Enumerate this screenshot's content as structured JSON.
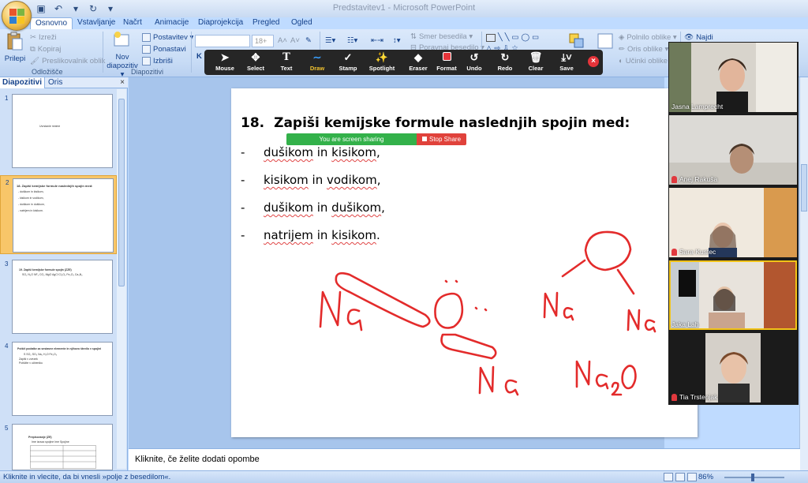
{
  "window": {
    "title": "Predstavitev1 - Microsoft PowerPoint"
  },
  "ribbon_tabs": [
    "Osnovno",
    "Vstavljanje",
    "Načrt",
    "Animacije",
    "Diaprojekcija",
    "Pregled",
    "Ogled"
  ],
  "ribbon": {
    "clipboard": {
      "paste": "Prilepi",
      "cut": "Izreži",
      "copy": "Kopiraj",
      "format_painter": "Preslikovalnik oblik",
      "label": "Odložišče"
    },
    "slides": {
      "new_slide_line1": "Nov",
      "new_slide_line2": "diapozitiv ▾",
      "layout": "Postavitev ▾",
      "reset": "Ponastavi",
      "delete": "Izbriši",
      "label": "Diapozitivi"
    },
    "font": {
      "size": "18+",
      "bold": "K"
    },
    "paragraph": {
      "text_direction": "Smer besedila ▾",
      "align_text": "Poravnaj besedilo ▾"
    },
    "drawing": {
      "fill": "Polnilo oblike ▾",
      "outline": "Oris oblike ▾",
      "effects": "Učinki oblike ▾"
    },
    "editing": {
      "find": "Najdi"
    }
  },
  "zoom_toolbar": {
    "tools": [
      {
        "label": "Mouse",
        "icon": "cursor-icon"
      },
      {
        "label": "Select",
        "icon": "move-icon"
      },
      {
        "label": "Text",
        "icon": "text-icon"
      },
      {
        "label": "Draw",
        "icon": "draw-icon"
      },
      {
        "label": "Stamp",
        "icon": "checkmark-icon"
      },
      {
        "label": "Spotlight",
        "icon": "wand-icon"
      },
      {
        "label": "Eraser",
        "icon": "eraser-icon"
      },
      {
        "label": "Format",
        "icon": "color-square-icon"
      },
      {
        "label": "Undo",
        "icon": "undo-icon"
      },
      {
        "label": "Redo",
        "icon": "redo-icon"
      },
      {
        "label": "Clear",
        "icon": "trash-icon"
      },
      {
        "label": "Save",
        "icon": "save-icon"
      }
    ],
    "selected": "Draw",
    "sharing_text": "You are screen sharing",
    "stop_share": "Stop Share"
  },
  "left_pane": {
    "tabs": [
      "Diapozitivi",
      "Oris"
    ],
    "close": "×",
    "thumbnails": [
      {
        "num": "1",
        "lines": [
          "Uvrstanie mnime"
        ]
      },
      {
        "num": "2",
        "lines": [
          "18.  Zapiši kemijske formule naslednjih spojin med:",
          "-  dušikom in kisikom,",
          "-  kisikom in vodikom,",
          "-  dušikom in dušikom,",
          "-  natrijem in kisikom."
        ]
      },
      {
        "num": "3",
        "lines": [
          "19.  Zapiši kemijske formule spojin (ZZE)",
          "SO₂   N₂O   NF₃   CO₂   MgO    AgCl   Cl₂O₃   Fe₂O₃   Ca₃N₂"
        ]
      },
      {
        "num": "4",
        "lines": [
          "Poišči podatke za sestavne elemente in njihovo število v spojini",
          "S    SO₂    SO₃    Na₂   H₂O     Fe₂O₃",
          "Zapiši v zvezek",
          "Poiščite v učbeniku"
        ]
      },
      {
        "num": "5",
        "lines": [
          "Prepisovanje (ZE)",
          "Ime izraza spojine        Ime Spojine"
        ]
      }
    ]
  },
  "slide": {
    "number": "18.",
    "title": "Zapiši kemijske formule naslednjih spojin med:",
    "bullets": [
      {
        "dash": "-",
        "parts": [
          "dušikom",
          " in ",
          "kisikom",
          ","
        ]
      },
      {
        "dash": "-",
        "parts": [
          "kisikom",
          " in ",
          "vodikom",
          ","
        ]
      },
      {
        "dash": "-",
        "parts": [
          "dušikom",
          " in ",
          "dušikom",
          ","
        ]
      },
      {
        "dash": "-",
        "parts": [
          "natrijem",
          " in ",
          "kisikom",
          "."
        ]
      }
    ],
    "ink_labels": [
      "Na",
      "O",
      "Na",
      "Na",
      "Na",
      "Na₂O"
    ]
  },
  "notes_placeholder": "Kliknite, če želite dodati opombe",
  "status": {
    "message": "Kliknite in vlecite, da bi vnesli »polje z besedilom«.",
    "zoom": "86%",
    "zoom_value_percent": 86
  },
  "participants": [
    {
      "name": "Jasna Lamprecht",
      "muted": false,
      "active": false
    },
    {
      "name": "Anej Rakuša",
      "muted": true,
      "active": false
    },
    {
      "name": "Sara Kustec",
      "muted": true,
      "active": false
    },
    {
      "name": "Jaka Lah",
      "muted": false,
      "active": true
    },
    {
      "name": "Tia Trstenjak",
      "muted": true,
      "active": false
    }
  ],
  "colors": {
    "ink": "#e32b2b",
    "share_green": "#33b14a",
    "stop_red": "#e0423b",
    "active_speaker": "#f2c318"
  }
}
